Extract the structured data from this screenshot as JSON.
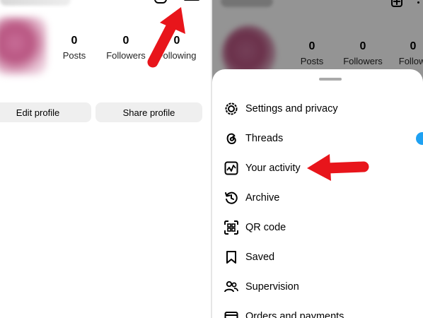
{
  "left_profile": {
    "stats": [
      {
        "value": "0",
        "label": "Posts"
      },
      {
        "value": "0",
        "label": "Followers"
      },
      {
        "value": "0",
        "label": "Following"
      }
    ],
    "buttons": {
      "edit": "Edit profile",
      "share": "Share profile"
    }
  },
  "right_profile": {
    "stats": [
      {
        "value": "0",
        "label": "Posts"
      },
      {
        "value": "0",
        "label": "Followers"
      },
      {
        "value": "0",
        "label": "Followi"
      }
    ]
  },
  "menu_sheet": {
    "items": [
      {
        "label": "Settings and privacy",
        "icon": "settings-gear-icon"
      },
      {
        "label": "Threads",
        "icon": "threads-icon",
        "badge_color": "#1ea1f2"
      },
      {
        "label": "Your activity",
        "icon": "activity-icon"
      },
      {
        "label": "Archive",
        "icon": "archive-history-icon"
      },
      {
        "label": "QR code",
        "icon": "qr-code-icon"
      },
      {
        "label": "Saved",
        "icon": "bookmark-icon"
      },
      {
        "label": "Supervision",
        "icon": "supervision-people-icon"
      },
      {
        "label": "Orders and payments",
        "icon": "card-icon"
      }
    ]
  },
  "colors": {
    "annotation_arrow": "#e8151b",
    "button_bg": "#efefef",
    "badge": "#1ea1f2",
    "dim_overlay": "rgba(0,0,0,0.42)"
  }
}
